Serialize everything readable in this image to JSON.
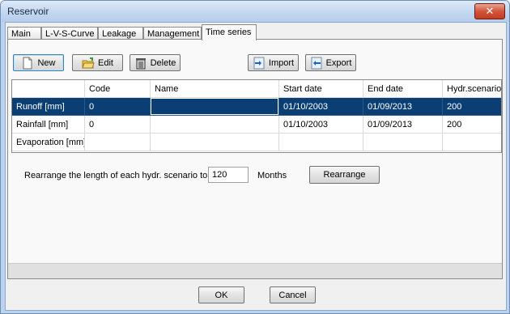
{
  "window": {
    "title": "Reservoir",
    "close_label": "✕"
  },
  "tabs": [
    {
      "label": "Main"
    },
    {
      "label": "L-V-S-Curve"
    },
    {
      "label": "Leakage"
    },
    {
      "label": "Management"
    },
    {
      "label": "Time series",
      "active": true
    }
  ],
  "toolbar": {
    "new_label": "New",
    "edit_label": "Edit",
    "delete_label": "Delete",
    "import_label": "Import",
    "export_label": "Export"
  },
  "grid": {
    "columns": [
      "",
      "Code",
      "Name",
      "Start date",
      "End date",
      "Hydr.scenarios"
    ],
    "rows": [
      [
        "Runoff [mm]",
        "0",
        "",
        "01/10/2003",
        "01/09/2013",
        "200"
      ],
      [
        "Rainfall [mm]",
        "0",
        "",
        "01/10/2003",
        "01/09/2013",
        "200"
      ],
      [
        "Evaporation [mm]",
        "",
        "",
        "",
        "",
        ""
      ]
    ],
    "selected_row": 0
  },
  "rearrange": {
    "label": "Rearrange the length of each hydr. scenario to",
    "value": "120",
    "unit": "Months",
    "button_label": "Rearrange"
  },
  "footer": {
    "ok_label": "OK",
    "cancel_label": "Cancel"
  }
}
